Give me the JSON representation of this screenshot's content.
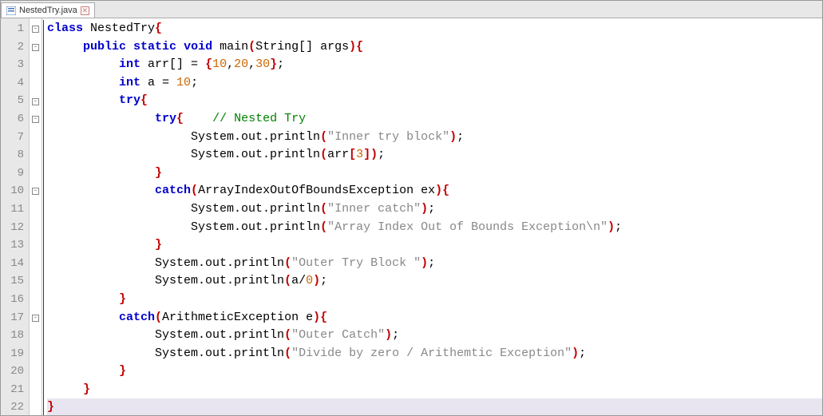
{
  "tab": {
    "label": "NestedTry.java",
    "close_tooltip": "Close"
  },
  "line_count": 22,
  "fold_markers": {
    "1": "minus",
    "2": "minus",
    "5": "minus",
    "6": "minus",
    "10": "minus",
    "17": "minus"
  },
  "code": {
    "l1": {
      "kw1": "class",
      "name": " NestedTry",
      "br1": "{"
    },
    "l2": {
      "kw1": "public",
      "kw2": "static",
      "kw3": "void",
      "name": " main",
      "paren1": "(",
      "str": "String",
      "arr": "[] args",
      "paren2": ")",
      "br": "{"
    },
    "l3": {
      "type": "int",
      "name": " arr",
      "arr": "[] = ",
      "br1": "{",
      "n1": "10",
      "c1": ",",
      "n2": "20",
      "c2": ",",
      "n3": "30",
      "br2": "}",
      "semi": ";"
    },
    "l4": {
      "type": "int",
      "name": " a = ",
      "n1": "10",
      "semi": ";"
    },
    "l5": {
      "kw": "try",
      "br": "{"
    },
    "l6": {
      "kw": "try",
      "br": "{",
      "sp": "    ",
      "comment": "// Nested Try"
    },
    "l7": {
      "call": "System.out.println",
      "p1": "(",
      "str": "\"Inner try block\"",
      "p2": ")",
      "semi": ";"
    },
    "l8": {
      "call": "System.out.println",
      "p1": "(",
      "arg": "arr",
      "b1": "[",
      "n": "3",
      "b2": "]",
      "p2": ")",
      "semi": ";"
    },
    "l9": {
      "br": "}"
    },
    "l10": {
      "kw": "catch",
      "p1": "(",
      "type": "ArrayIndexOutOfBoundsException ex",
      "p2": ")",
      "br": "{"
    },
    "l11": {
      "call": "System.out.println",
      "p1": "(",
      "str": "\"Inner catch\"",
      "p2": ")",
      "semi": ";"
    },
    "l12": {
      "call": "System.out.println",
      "p1": "(",
      "str": "\"Array Index Out of Bounds Exception\\n\"",
      "p2": ")",
      "semi": ";"
    },
    "l13": {
      "br": "}"
    },
    "l14": {
      "call": "System.out.println",
      "p1": "(",
      "str": "\"Outer Try Block \"",
      "p2": ")",
      "semi": ";"
    },
    "l15": {
      "call": "System.out.println",
      "p1": "(",
      "arg": "a/",
      "n": "0",
      "p2": ")",
      "semi": ";"
    },
    "l16": {
      "br": "}"
    },
    "l17": {
      "kw": "catch",
      "p1": "(",
      "type": "ArithmeticException e",
      "p2": ")",
      "br": "{"
    },
    "l18": {
      "call": "System.out.println",
      "p1": "(",
      "str": "\"Outer Catch\"",
      "p2": ")",
      "semi": ";"
    },
    "l19": {
      "call": "System.out.println",
      "p1": "(",
      "str": "\"Divide by zero / Arithemtic Exception\"",
      "p2": ")",
      "semi": ";"
    },
    "l20": {
      "br": "}"
    },
    "l21": {
      "br": "}"
    },
    "l22": {
      "br": "}"
    }
  }
}
